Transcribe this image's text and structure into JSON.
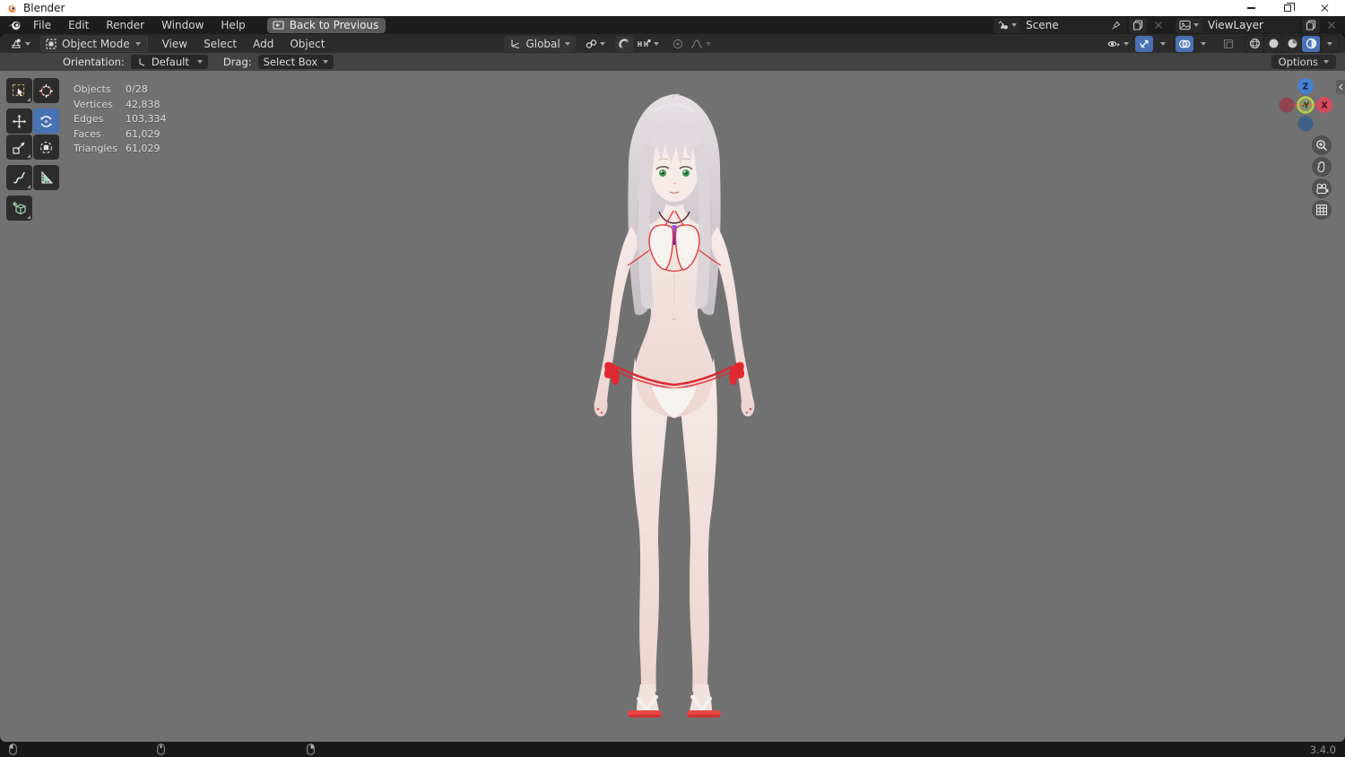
{
  "window": {
    "title": "Blender"
  },
  "topbar": {
    "menus": [
      "File",
      "Edit",
      "Render",
      "Window",
      "Help"
    ],
    "back_button": "Back to Previous",
    "scene_value": "Scene",
    "layer_value": "ViewLayer"
  },
  "viewport_header": {
    "mode": "Object Mode",
    "menus": [
      "View",
      "Select",
      "Add",
      "Object"
    ],
    "orientation": "Global"
  },
  "tool_settings": {
    "orientation_label": "Orientation:",
    "orientation_value": "Default",
    "drag_label": "Drag:",
    "drag_value": "Select Box",
    "options_label": "Options"
  },
  "stats": {
    "rows": [
      {
        "label": "Objects",
        "value": "0/28"
      },
      {
        "label": "Vertices",
        "value": "42,838"
      },
      {
        "label": "Edges",
        "value": "103,334"
      },
      {
        "label": "Faces",
        "value": "61,029"
      },
      {
        "label": "Triangles",
        "value": "61,029"
      }
    ]
  },
  "nav_gizmo": {
    "axis_top": "Z",
    "axis_center": "-Y",
    "axis_right": "X"
  },
  "status_bar": {
    "version": "3.4.0"
  },
  "icons": {
    "tools": [
      "select-box",
      "cursor",
      "move",
      "rotate",
      "scale",
      "transform",
      "annotate",
      "measure",
      "add-cube"
    ],
    "nav": [
      "zoom",
      "pan",
      "camera-view",
      "grid-toggle"
    ]
  },
  "colors": {
    "accent_blue": "#4772b3",
    "viewport_gray": "#717171",
    "axis_x_red": "#e0455a",
    "axis_z_blue": "#4a7fd0",
    "axis_y_green": "#aacb3f",
    "bikini_trim_red": "#e02f35",
    "hair_silver": "#d4cdd2",
    "logo_orange": "#ff7a2d"
  }
}
